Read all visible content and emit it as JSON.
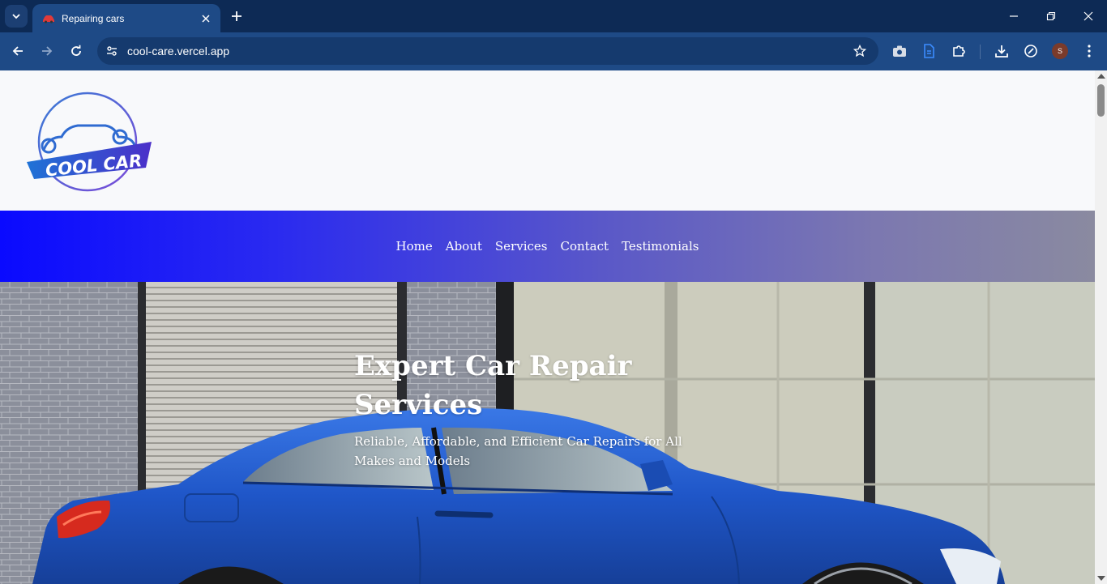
{
  "browser": {
    "tab": {
      "title": "Repairing cars"
    },
    "omnibox": {
      "url": "cool-care.vercel.app"
    },
    "profile_initial": "S",
    "colors": {
      "tabstrip": "#0d2a55",
      "toolbar": "#1e4a86"
    }
  },
  "site": {
    "logo": {
      "text": "COOL CAR"
    },
    "nav": {
      "items": [
        {
          "label": "Home"
        },
        {
          "label": "About"
        },
        {
          "label": "Services"
        },
        {
          "label": "Contact"
        },
        {
          "label": "Testimonials"
        }
      ]
    },
    "hero": {
      "title": "Expert Car Repair Services",
      "subtitle": "Reliable, Affordable, and Efficient Car Repairs for All Makes and Models"
    },
    "colors": {
      "nav_gradient_start": "#0a0aff",
      "nav_gradient_end": "#8a8aa0",
      "car_blue": "#1f56c8"
    }
  }
}
